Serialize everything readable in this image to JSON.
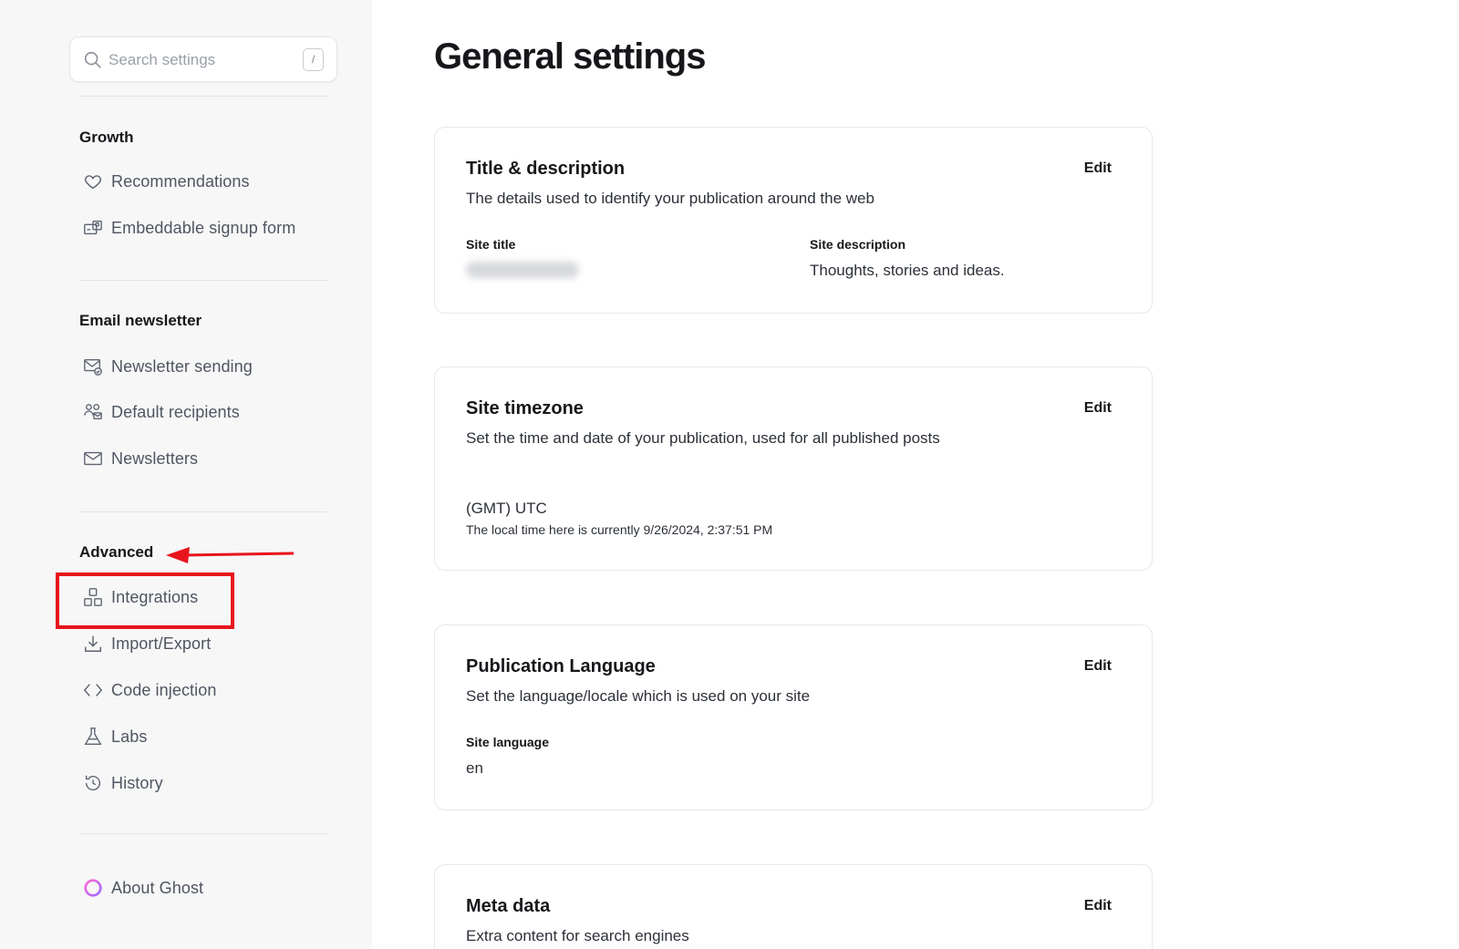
{
  "search": {
    "placeholder": "Search settings",
    "shortcut": "/"
  },
  "sidebar": {
    "groups": [
      {
        "title": "Growth",
        "items": [
          {
            "label": "Recommendations",
            "icon": "heart-icon"
          },
          {
            "label": "Embeddable signup form",
            "icon": "signup-form-icon"
          }
        ]
      },
      {
        "title": "Email newsletter",
        "items": [
          {
            "label": "Newsletter sending",
            "icon": "mail-check-icon"
          },
          {
            "label": "Default recipients",
            "icon": "users-icon"
          },
          {
            "label": "Newsletters",
            "icon": "envelope-icon"
          }
        ]
      },
      {
        "title": "Advanced",
        "items": [
          {
            "label": "Integrations",
            "icon": "integrations-icon"
          },
          {
            "label": "Import/Export",
            "icon": "download-icon"
          },
          {
            "label": "Code injection",
            "icon": "code-icon"
          },
          {
            "label": "Labs",
            "icon": "flask-icon"
          },
          {
            "label": "History",
            "icon": "history-icon"
          }
        ]
      }
    ],
    "about": {
      "label": "About Ghost",
      "icon": "ghost-logo-icon"
    }
  },
  "main": {
    "title": "General settings",
    "cards": {
      "title_desc": {
        "title": "Title & description",
        "description": "The details used to identify your publication around the web",
        "edit": "Edit",
        "site_title_label": "Site title",
        "site_description_label": "Site description",
        "site_description_value": "Thoughts, stories and ideas."
      },
      "timezone": {
        "title": "Site timezone",
        "description": "Set the time and date of your publication, used for all published posts",
        "edit": "Edit",
        "value": "(GMT) UTC",
        "note": "The local time here is currently 9/26/2024, 2:37:51 PM"
      },
      "language": {
        "title": "Publication Language",
        "description": "Set the language/locale which is used on your site",
        "edit": "Edit",
        "label": "Site language",
        "value": "en"
      },
      "meta": {
        "title": "Meta data",
        "description": "Extra content for search engines",
        "edit": "Edit"
      }
    }
  },
  "colors": {
    "annotation": "#e8141c",
    "sidebar_bg": "#f7f7f8"
  }
}
